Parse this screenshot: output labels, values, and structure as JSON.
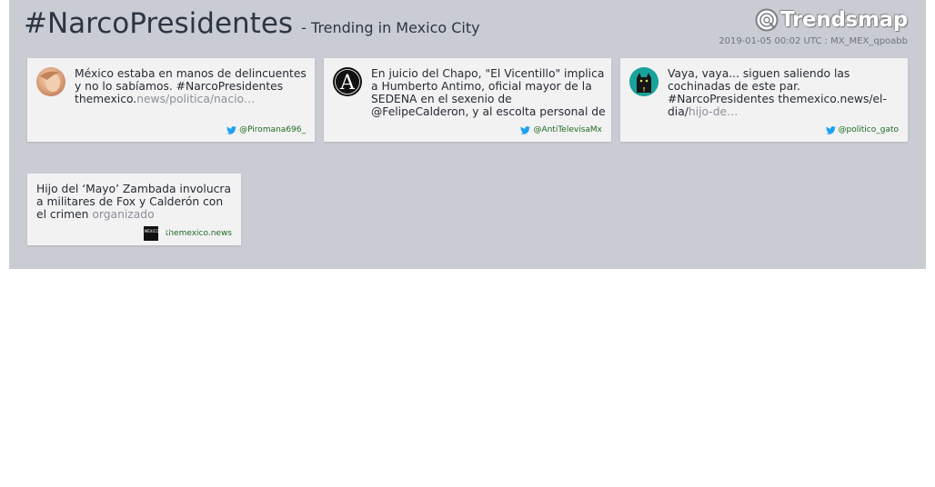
{
  "header": {
    "hashtag": "#NarcoPresidentes",
    "subtitle": "- Trending in Mexico City",
    "logo_text": "Trendsmap",
    "timestamp": "2019-01-05 00:02 UTC : MX_MEX_qpoabb"
  },
  "colors": {
    "panel_bg": "#caccd3",
    "card_bg": "#f2f2f3",
    "twitter_blue": "#1da1f2",
    "byline_green": "#1f6a1f"
  },
  "tweets": [
    {
      "text": "México estaba en manos de delincuentes y no lo sabíamos. #NarcoPresidentes themexico.",
      "muted": "news/politica/nacio…",
      "handle": "@Piromana696_",
      "avatar": "photo-avatar"
    },
    {
      "text": "En juicio del Chapo, \"El Vicentillo\" implica a Humberto Antimo, oficial mayor de la SEDENA en el sexenio de @FelipeCalderon, y al escolta personal de",
      "muted": "",
      "handle": "@AntiTelevisaMx",
      "avatar": "letter-a-avatar",
      "avatar_letter": "A"
    },
    {
      "text": "Vaya, vaya... siguen saliendo las cochinadas de este par. #NarcoPresidentes themexico.news/el-dia/",
      "muted": "hijo-de…",
      "handle": "@politico_gato",
      "avatar": "cat-avatar"
    }
  ],
  "news": {
    "title": "Hijo del ‘Mayo’ Zambada involucra a militares de Fox y Calderón con el crimen",
    "muted": "organizado",
    "source": "themexico.news",
    "thumb_text": "MÉXICO NEWS"
  }
}
